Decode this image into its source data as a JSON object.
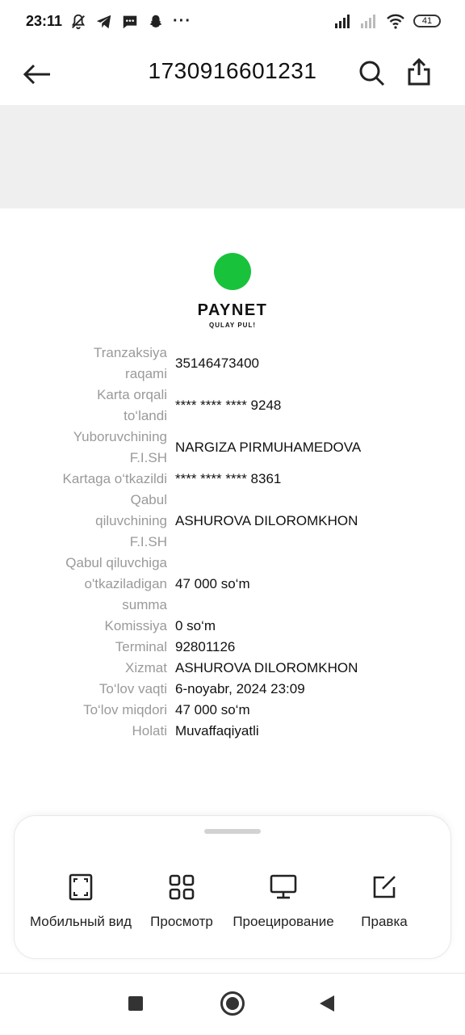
{
  "status_bar": {
    "time": "23:11",
    "battery": "41"
  },
  "app_bar": {
    "title": "1730916601231"
  },
  "logo": {
    "name": "PAYNET",
    "tagline": "QULAY PUL!",
    "accent": "#19c23b"
  },
  "receipt": {
    "rows": [
      {
        "label": "Tranzaksiya raqami",
        "value": "35146473400"
      },
      {
        "label": "Karta orqali to‘landi",
        "value": "**** **** **** 9248"
      },
      {
        "label": "Yuboruvchining F.I.SH",
        "value": "NARGIZA PIRMUHAMEDOVA"
      },
      {
        "label": "Kartaga o‘tkazildi",
        "value": "**** **** **** 8361"
      },
      {
        "label": "Qabul qiluvchining F.I.SH",
        "value": "ASHUROVA DILOROMKHON"
      },
      {
        "label": "Qabul qiluvchiga o'tkaziladigan summa",
        "value": "47 000 so‘m"
      },
      {
        "label": "Komissiya",
        "value": "0 so‘m"
      },
      {
        "label": "Terminal",
        "value": "92801126"
      },
      {
        "label": "Xizmat",
        "value": "ASHUROVA DILOROMKHON"
      },
      {
        "label": "To‘lov vaqti",
        "value": "6-noyabr, 2024 23:09"
      },
      {
        "label": "To‘lov miqdori",
        "value": "47 000 so‘m"
      },
      {
        "label": "Holati",
        "value": "Muvaffaqiyatli"
      }
    ]
  },
  "bottom_sheet": {
    "actions": [
      {
        "label": "Мобильный вид",
        "icon": "mobile-view-icon"
      },
      {
        "label": "Просмотр",
        "icon": "grid-view-icon"
      },
      {
        "label": "Проецирование",
        "icon": "monitor-icon"
      },
      {
        "label": "Правка",
        "icon": "edit-icon"
      }
    ]
  }
}
